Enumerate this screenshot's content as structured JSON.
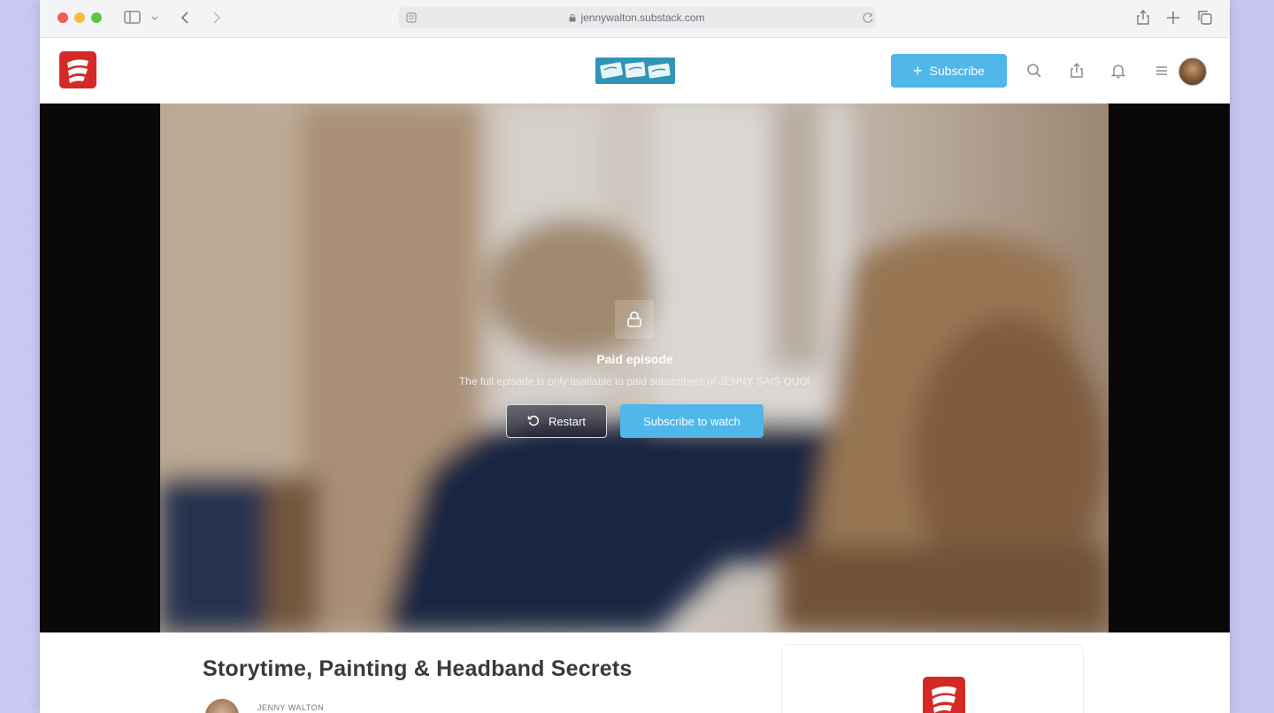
{
  "browser": {
    "url": "jennywalton.substack.com"
  },
  "header": {
    "subscribe_label": "Subscribe"
  },
  "video": {
    "lock_title": "Paid episode",
    "lock_message": "The full episode is only available to paid subscribers of JENNY SAIS QUOI",
    "restart_label": "Restart",
    "subscribe_watch_label": "Subscribe to watch"
  },
  "post": {
    "title": "Storytime, Painting & Headband Secrets",
    "author": "JENNY WALTON"
  },
  "colors": {
    "accent": "#4fb7ea",
    "brand_red": "#d42a26",
    "brand_teal": "#2f95b6"
  }
}
